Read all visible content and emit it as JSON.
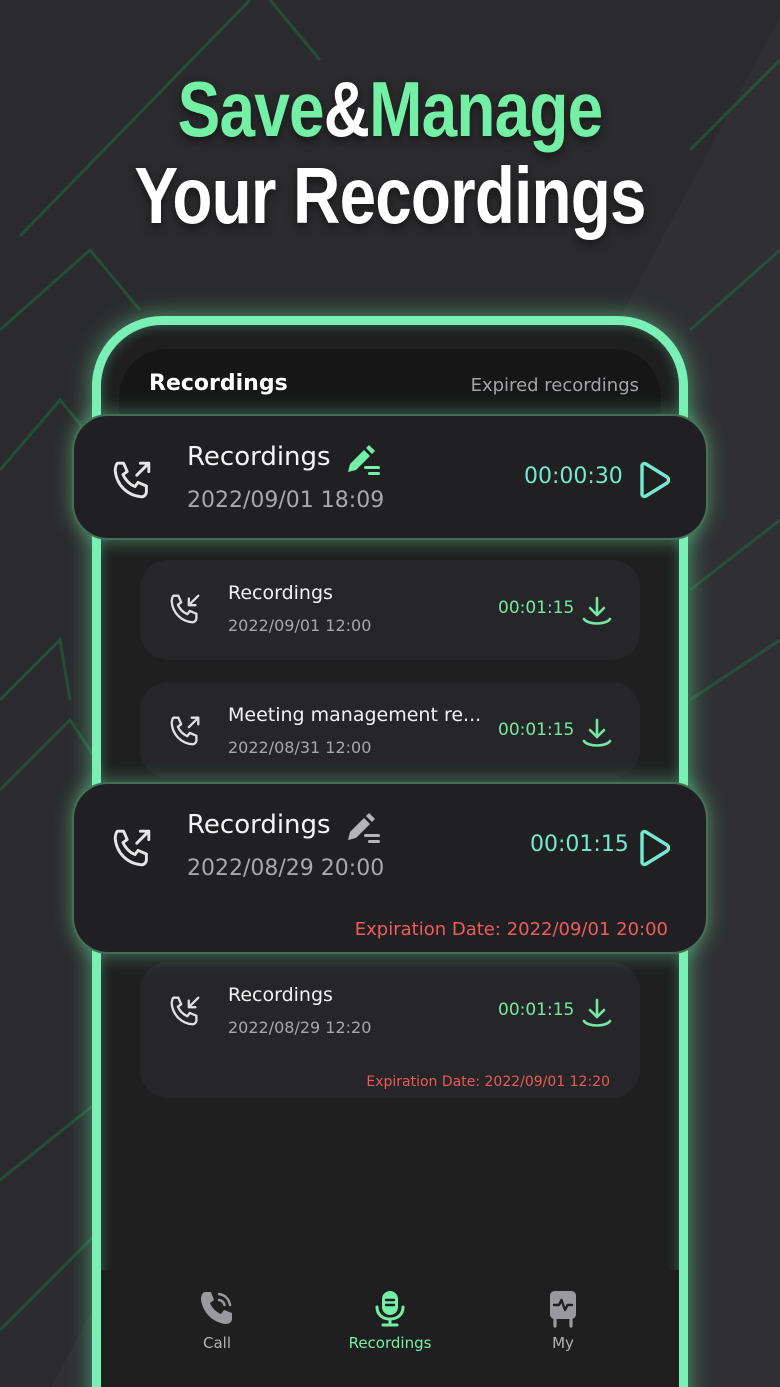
{
  "headline": {
    "line1_part1": "Save",
    "line1_amp": "&",
    "line1_part2": "Manage",
    "line2": "Your Recordings"
  },
  "header": {
    "title": "Recordings",
    "expired_link": "Expired recordings"
  },
  "recordings": [
    {
      "title": "Recordings",
      "date": "2022/09/01   18:09",
      "duration": "00:00:30",
      "direction": "outgoing",
      "action": "play",
      "highlighted": true,
      "edit_icon": "edit-icon-green"
    },
    {
      "title": "Recordings",
      "date": "2022/09/01  12:00",
      "duration": "00:01:15",
      "direction": "incoming",
      "action": "download"
    },
    {
      "title": "Meeting management re...",
      "date": "2022/08/31  12:00",
      "duration": "00:01:15",
      "direction": "outgoing",
      "action": "download"
    },
    {
      "title": "Recordings",
      "date": "2022/08/29  20:00",
      "duration": "00:01:15",
      "direction": "outgoing",
      "action": "play",
      "highlighted": true,
      "edit_icon": "edit-icon-gray",
      "expiration": "Expiration Date: 2022/09/01  20:00"
    },
    {
      "title": "Recordings",
      "date": "2022/08/29  12:20",
      "duration": "00:01:15",
      "direction": "incoming",
      "action": "download",
      "expiration": "Expiration Date: 2022/09/01  12:20"
    }
  ],
  "tabs": [
    {
      "label": "Call",
      "icon": "phone-icon",
      "active": false
    },
    {
      "label": "Recordings",
      "icon": "microphone-icon",
      "active": true
    },
    {
      "label": "My",
      "icon": "profile-icon",
      "active": false
    }
  ],
  "colors": {
    "accent": "#74efa6",
    "accent_cyan": "#74e9d0",
    "expiration_red": "#ee5c5c",
    "background": "#2b2b2d"
  }
}
